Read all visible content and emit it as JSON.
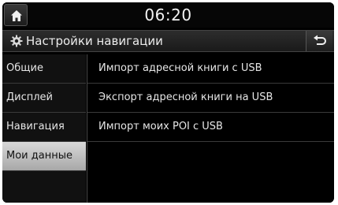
{
  "statusbar": {
    "time": "06:20"
  },
  "header": {
    "title": "Настройки навигации"
  },
  "sidebar": {
    "items": [
      {
        "label": "Общие"
      },
      {
        "label": "Дисплей"
      },
      {
        "label": "Навигация"
      },
      {
        "label": "Мои данные",
        "active": true
      }
    ]
  },
  "main": {
    "rows": [
      {
        "label": "Импорт адресной книги с USB"
      },
      {
        "label": "Экспорт адресной книги на USB"
      },
      {
        "label": "Импорт моих POI с USB"
      }
    ]
  },
  "icons": {
    "home": "home-icon",
    "settings": "gear-icon",
    "back": "back-arrow-icon"
  },
  "colors": {
    "background": "#000000",
    "active_tab": "#c8c8c8",
    "text": "#e6e6e6"
  }
}
